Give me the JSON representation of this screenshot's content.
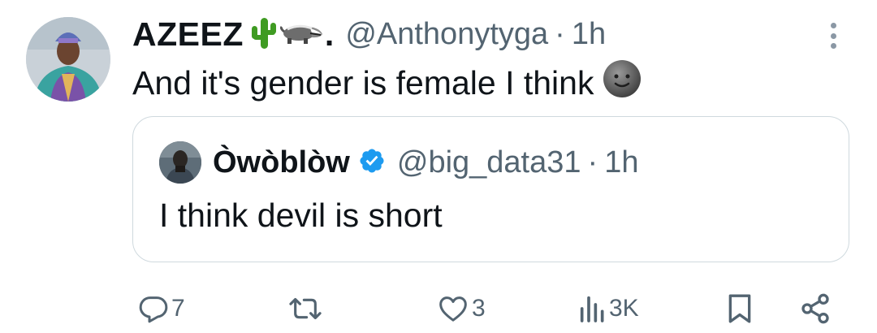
{
  "tweet": {
    "display_name": "AZEEZ",
    "name_emojis": [
      "cactus-emoji",
      "badger-emoji"
    ],
    "name_suffix": ".",
    "handle": "@Anthonytyga",
    "separator": "·",
    "time": "1h",
    "text": "And it's gender is female I think",
    "text_emoji": "new-moon-face-emoji"
  },
  "quoted": {
    "display_name": "Òwòblòw",
    "verified": true,
    "handle": "@big_data31",
    "separator": "·",
    "time": "1h",
    "text": "I think devil is short"
  },
  "actions": {
    "reply_count": "7",
    "repost_count": "",
    "like_count": "3",
    "views_count": "3K"
  },
  "colors": {
    "text_primary": "#0f1419",
    "text_secondary": "#536471",
    "border": "#cfd9de",
    "verified_blue": "#1d9bf0",
    "cactus_green": "#3f9b22"
  },
  "icons": [
    "more-vertical-icon",
    "reply-icon",
    "repost-icon",
    "like-icon",
    "views-icon",
    "bookmark-icon",
    "share-icon",
    "verified-badge-icon"
  ]
}
